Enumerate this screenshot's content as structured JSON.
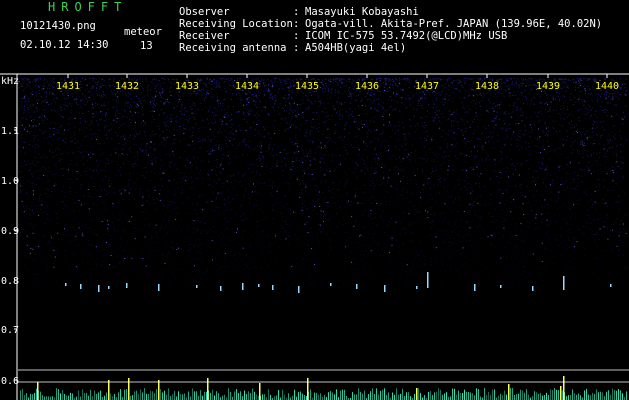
{
  "header": {
    "brand": "HROFFT",
    "filename": "10121430.png",
    "datetime": "02.10.12 14:30",
    "meteor_label": "meteor",
    "meteor_count": "13",
    "fields": [
      {
        "label": "Observer",
        "value": "Masayuki Kobayashi"
      },
      {
        "label": "Receiving Location",
        "value": "Ogata-vill. Akita-Pref. JAPAN (139.96E, 40.02N)"
      },
      {
        "label": "Receiver",
        "value": "ICOM IC-575 53.7492(@LCD)MHz USB"
      },
      {
        "label": "Receiving antenna",
        "value": "A504HB(yagi 4el)"
      }
    ]
  },
  "plot": {
    "y_unit": "kHz",
    "y_ticks": [
      "1.1",
      "1.0",
      "0.9",
      "0.8",
      "0.7",
      "0.6"
    ],
    "x_ticks": [
      "1431",
      "1432",
      "1433",
      "1434",
      "1435",
      "1436",
      "1437",
      "1438",
      "1439",
      "1440"
    ],
    "colors": {
      "background": "#000000",
      "noise": "#2a2ab8",
      "echo": "#9ad8ff",
      "trace": "#37ffd0",
      "spike": "#ffff55",
      "tick_label": "#ffff00",
      "axis": "#ffffff"
    }
  }
}
